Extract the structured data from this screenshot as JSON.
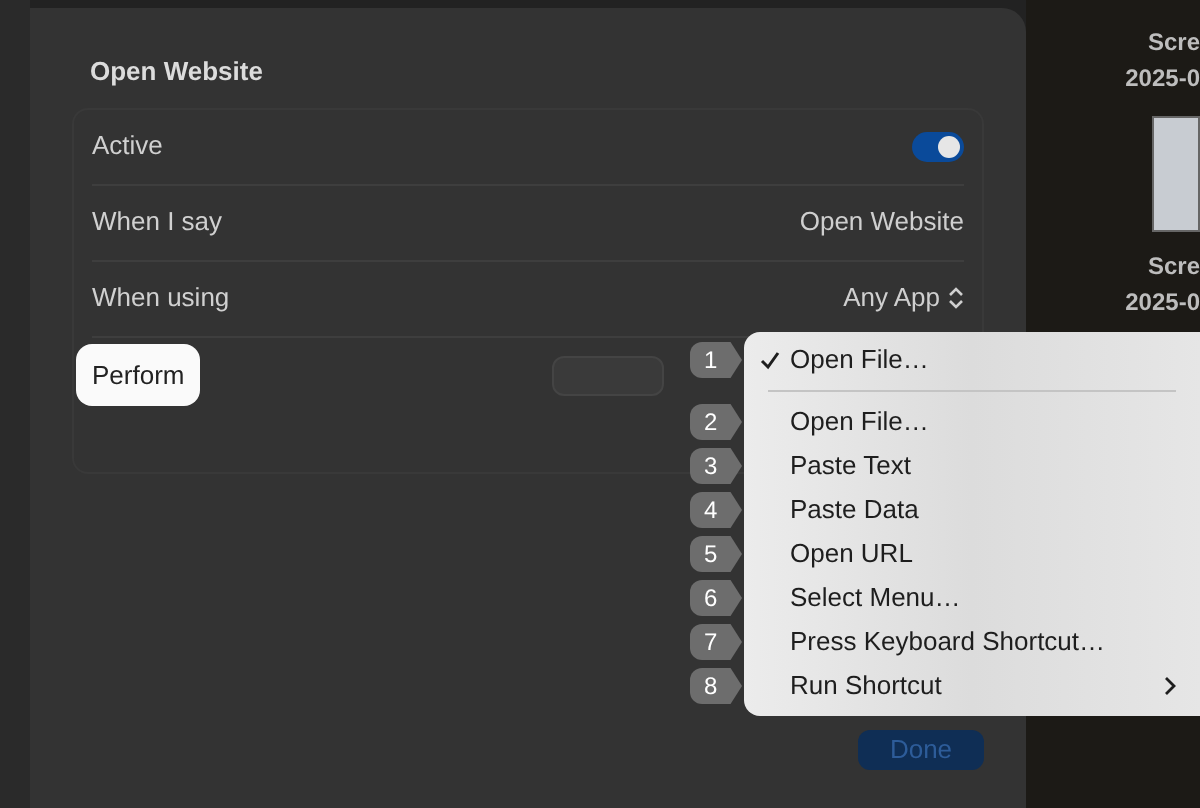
{
  "sheet": {
    "title": "Open Website",
    "rows": [
      {
        "kind": "toggle",
        "label": "Active",
        "on": true
      },
      {
        "kind": "value",
        "label": "When I say",
        "value": "Open Website"
      },
      {
        "kind": "popup",
        "label": "When using",
        "value": "Any App"
      },
      {
        "kind": "action",
        "label": "Perform",
        "highlighted": true
      }
    ],
    "done_button": "Done"
  },
  "menu": {
    "items": [
      {
        "badge": "1",
        "label": "Open File…",
        "checked": true,
        "submenu": false
      },
      {
        "badge": "2",
        "label": "Open File…",
        "checked": false,
        "submenu": false
      },
      {
        "badge": "3",
        "label": "Paste Text",
        "checked": false,
        "submenu": false
      },
      {
        "badge": "4",
        "label": "Paste Data",
        "checked": false,
        "submenu": false
      },
      {
        "badge": "5",
        "label": "Open URL",
        "checked": false,
        "submenu": false
      },
      {
        "badge": "6",
        "label": "Select Menu…",
        "checked": false,
        "submenu": false
      },
      {
        "badge": "7",
        "label": "Press Keyboard Shortcut…",
        "checked": false,
        "submenu": false
      },
      {
        "badge": "8",
        "label": "Run Shortcut",
        "checked": false,
        "submenu": true
      }
    ]
  },
  "desktop_files": [
    {
      "name": "Scre",
      "date": "2025-0"
    },
    {
      "name": "Scre",
      "date": "2025-0"
    }
  ]
}
